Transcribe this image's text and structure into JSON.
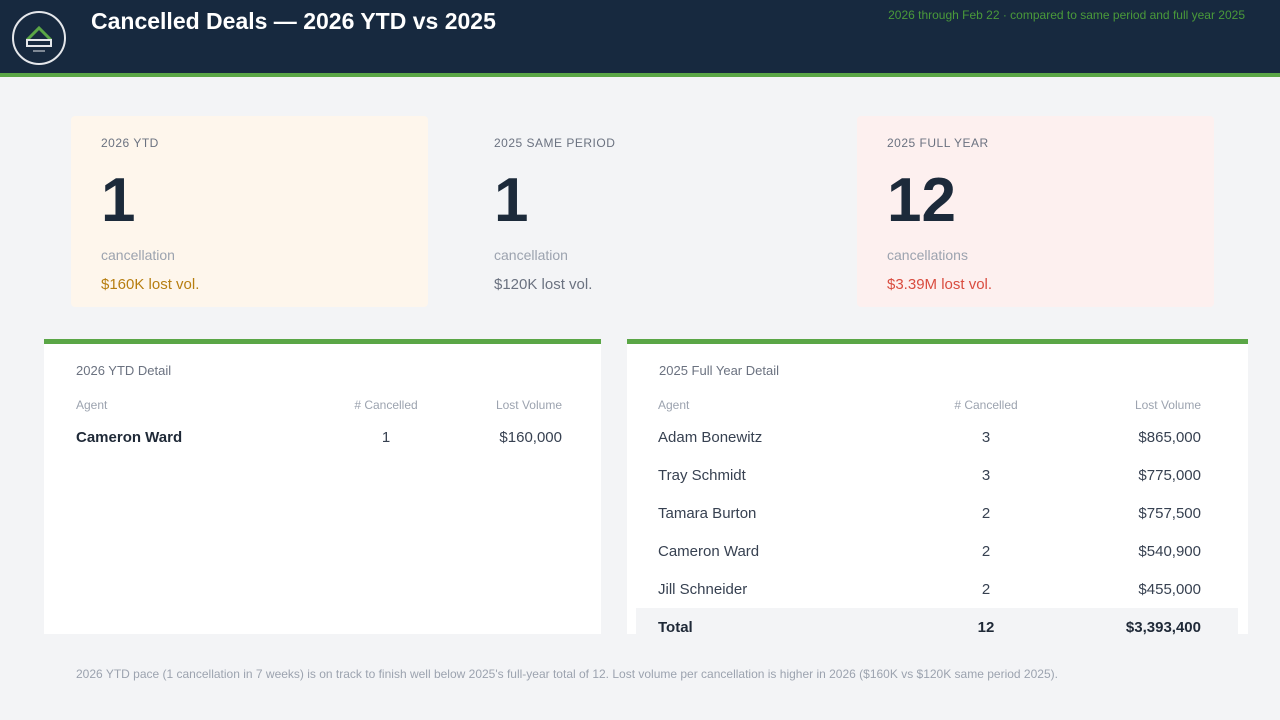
{
  "header": {
    "title": "Cancelled Deals — 2026 YTD vs 2025",
    "subtitle": "2026 through Feb 22 · compared to same period and full year 2025",
    "logo_icon": "house-logo-icon"
  },
  "summary_cards": [
    {
      "label": "2026 YTD",
      "value": "1",
      "unit": "cancellation",
      "lost": "$160K lost vol."
    },
    {
      "label": "2025 SAME PERIOD",
      "value": "1",
      "unit": "cancellation",
      "lost": "$120K lost vol."
    },
    {
      "label": "2025 FULL YEAR",
      "value": "12",
      "unit": "cancellations",
      "lost": "$3.39M lost vol."
    }
  ],
  "ytd_detail": {
    "title": "2026 YTD Detail",
    "columns": [
      "Agent",
      "# Cancelled",
      "Lost Volume"
    ],
    "rows": [
      {
        "agent": "Cameron Ward",
        "count": "1",
        "lost": "$160,000"
      }
    ]
  },
  "full_year_detail": {
    "title": "2025 Full Year Detail",
    "columns": [
      "Agent",
      "# Cancelled",
      "Lost Volume"
    ],
    "rows": [
      {
        "agent": "Adam Bonewitz",
        "count": "3",
        "lost": "$865,000"
      },
      {
        "agent": "Tray Schmidt",
        "count": "3",
        "lost": "$775,000"
      },
      {
        "agent": "Tamara Burton",
        "count": "2",
        "lost": "$757,500"
      },
      {
        "agent": "Cameron Ward",
        "count": "2",
        "lost": "$540,900"
      },
      {
        "agent": "Jill Schneider",
        "count": "2",
        "lost": "$455,000"
      }
    ],
    "total": {
      "label": "Total",
      "count": "12",
      "lost": "$3,393,400"
    }
  },
  "footnote": "2026 YTD pace (1 cancellation in 7 weeks) is on track to finish well below 2025's full-year total of 12. Lost volume per cancellation is higher in 2026 ($160K vs $120K same period 2025).",
  "colors": {
    "header_bg": "#17293f",
    "accent_green": "#5aa646",
    "ytd_lost": "#b77e10",
    "full_year_lost": "#d94c3f"
  }
}
